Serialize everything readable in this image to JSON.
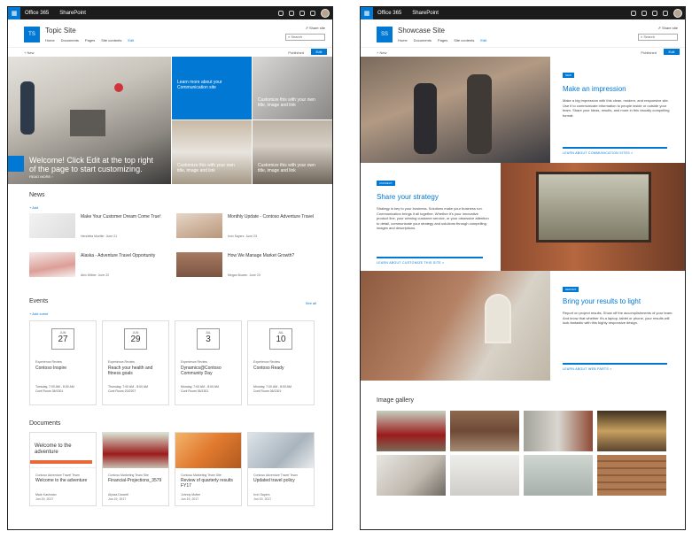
{
  "suite": {
    "app": "Office 365",
    "product": "SharePoint"
  },
  "left": {
    "logo": "TS",
    "title": "Topic Site",
    "nav": [
      "Home",
      "Documents",
      "Pages",
      "Site contents",
      "Edit"
    ],
    "share": "Share site",
    "search": "Search",
    "new": "New",
    "published": "Published",
    "edit": "Edit",
    "hero": {
      "main": "Welcome! Click Edit at the top right of the page to start customizing.",
      "readmore": "READ MORE",
      "t2": "Learn more about your Communication site",
      "t3": "Customize this with your own title, image and link",
      "t4": "Customize this with your own title, image and link",
      "t5": "Customize this with your own title, image and link"
    },
    "news_title": "News",
    "add": "Add",
    "news": [
      {
        "title": "Make Your Customer Dream Come True!",
        "author": "Henrietta Mueller",
        "date": "June 21"
      },
      {
        "title": "Monthly Update - Contoso Adventure Travel",
        "author": "Irvin Sayers",
        "date": "June 23"
      },
      {
        "title": "Alaska - Adventure Travel Opportunity",
        "author": "Alex Wilber",
        "date": "June 22"
      },
      {
        "title": "How We Manage Market Growth?",
        "author": "Megan Bowen",
        "date": "June 23"
      }
    ],
    "events_title": "Events",
    "add_event": "Add event",
    "see_all": "See all",
    "events": [
      {
        "month": "JUN",
        "day": "27",
        "cat": "Experience Review",
        "title": "Contoso Inspire",
        "time": "Tuesday, 7:00 AM - 8:00 AM",
        "room": "Conf Room 36/1301"
      },
      {
        "month": "JUN",
        "day": "29",
        "cat": "Experience Review",
        "title": "Reach your health and fitness goals",
        "time": "Thursday, 7:00 AM - 8:00 AM",
        "room": "Conf Room 20/2207"
      },
      {
        "month": "JUL",
        "day": "3",
        "cat": "Experience Review",
        "title": "Dynamics@Contoso Community Day",
        "time": "Monday, 7:00 AM - 8:00 AM",
        "room": "Conf Room 36/1301"
      },
      {
        "month": "JUL",
        "day": "10",
        "cat": "Experience Review",
        "title": "Contoso Ready",
        "time": "Monday, 7:00 AM - 8:00 AM",
        "room": "Conf Room 36/1301"
      }
    ],
    "docs_title": "Documents",
    "docs": [
      {
        "preview": "Welcome to the adventure",
        "site": "Contoso Adventure Travel Team",
        "title": "Welcome to the adventure",
        "author": "Mark Kashman",
        "date": "Jun 19, 2017"
      },
      {
        "site": "Contoso Marketing Team Site",
        "title": "Financial-Projections_3579",
        "author": "Alyssa Darwell",
        "date": "Jun 19, 2017"
      },
      {
        "site": "Contoso Marketing Team Site",
        "title": "Review of quarterly results FY17",
        "author": "Johnny Mutter",
        "date": "Jun 19, 2017"
      },
      {
        "site": "Contoso Adventure Travel Team",
        "title": "Updated travel policy",
        "author": "Irvin Sayers",
        "date": "Jun 19, 2017"
      }
    ]
  },
  "right": {
    "logo": "SS",
    "title": "Showcase Site",
    "nav": [
      "Home",
      "Documents",
      "Pages",
      "Site contents",
      "Edit"
    ],
    "share": "Share site",
    "search": "Search",
    "new": "New",
    "published": "Published",
    "edit": "Edit",
    "sections": [
      {
        "tag": "NEW",
        "heading": "Make an impression",
        "body": "Make a big impression with this clean, modern, and responsive site. Use it to communicate information to people inside or outside your team. Share your ideas, results, and more in this visually compelling format.",
        "link": "LEARN ABOUT COMMUNICATION SITES >"
      },
      {
        "tag": "CONNECT",
        "heading": "Share your strategy",
        "body": "Strategy is key to your business. Solutions make your business run. Communication brings it all together. Whether it's your innovative product line, your winning customer service, or your obsessive attention to detail, communicate your strategy and solutions through compelling images and descriptions.",
        "link": "LEARN ABOUT CUSTOMIZE THIS SITE >"
      },
      {
        "tag": "REPORT",
        "heading": "Bring your results to light",
        "body": "Report on project results. Show off the accomplishments of your team. And know that whether it's a laptop, tablet or phone, your results will look fantastic with this highly responsive design.",
        "link": "LEARN ABOUT WEB PARTS >"
      }
    ],
    "gallery_title": "Image gallery"
  },
  "colors": {
    "accent": "#0078d4",
    "suite_bar": "#1c1c1c"
  }
}
